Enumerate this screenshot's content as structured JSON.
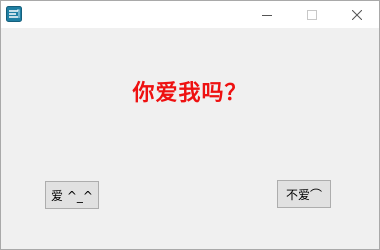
{
  "titlebar": {
    "title": "",
    "app_icon": "app-icon",
    "controls": {
      "minimize_icon": "minimize-icon",
      "maximize_icon": "maximize-icon",
      "close_icon": "close-icon"
    }
  },
  "main": {
    "question": "你爱我吗？",
    "question_color": "#ee1111",
    "love_button": "爱 ^_^",
    "not_love_button": "不爱⌒"
  }
}
